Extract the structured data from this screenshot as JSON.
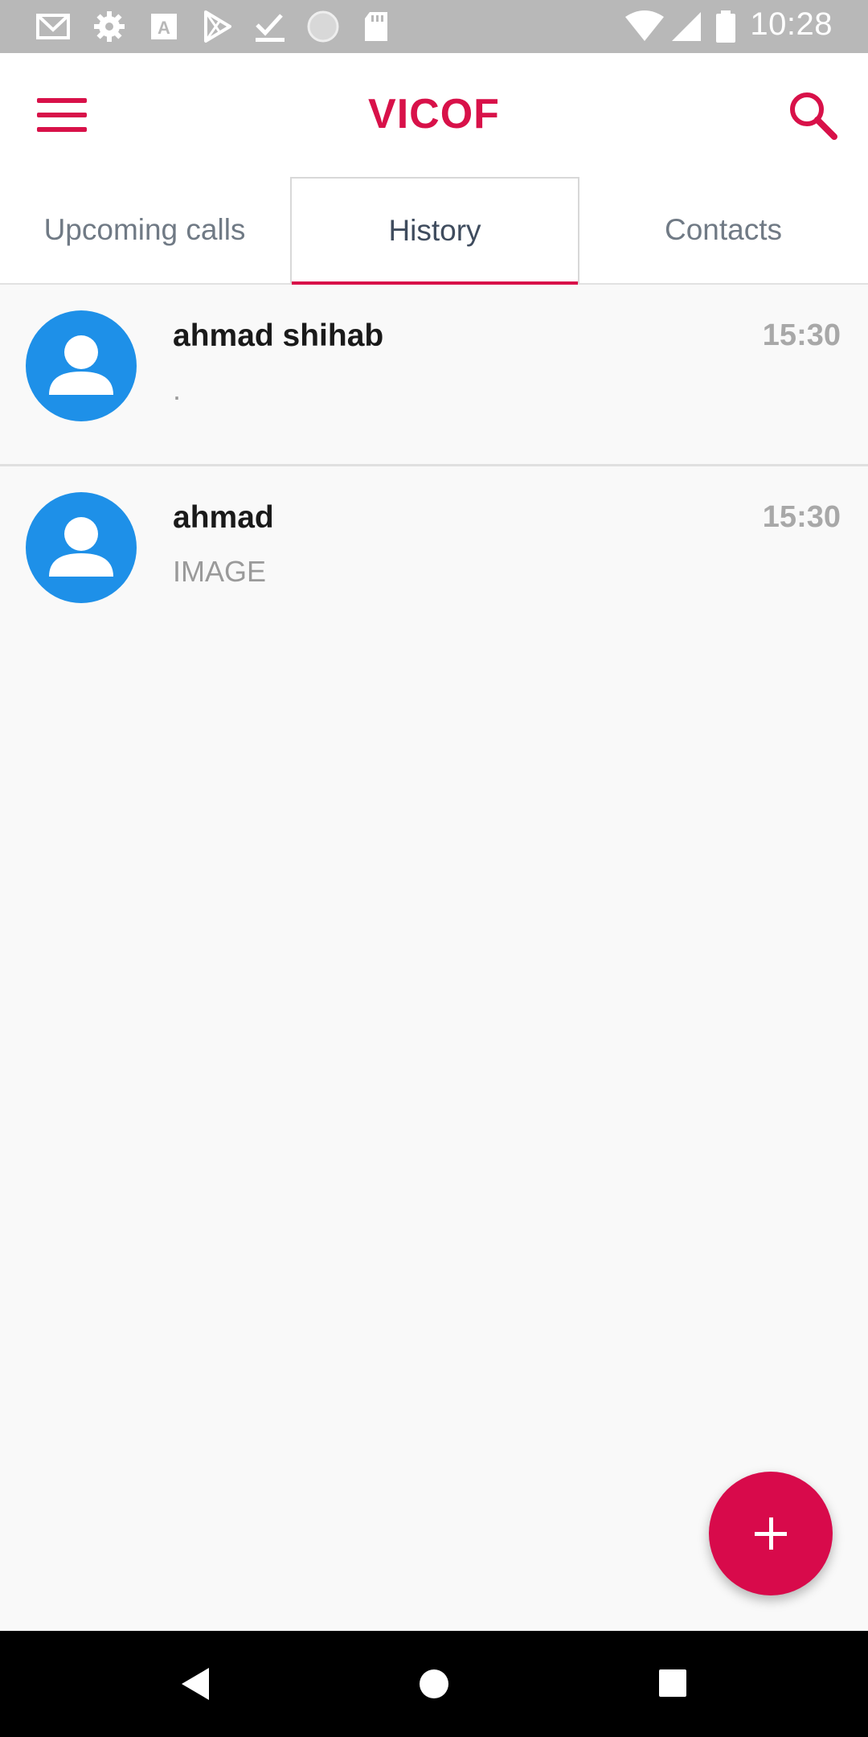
{
  "status_bar": {
    "time": "10:28",
    "icons": [
      "gmail-icon",
      "settings-icon",
      "font-a-icon",
      "play-store-icon",
      "download-done-icon",
      "sync-circle-icon",
      "sd-card-icon",
      "wifi-icon",
      "cell-signal-icon",
      "battery-icon"
    ]
  },
  "app_bar": {
    "title": "VICOF",
    "menu_icon": "hamburger-menu-icon",
    "search_icon": "search-icon"
  },
  "tabs": [
    {
      "label": "Upcoming calls",
      "active": false
    },
    {
      "label": "History",
      "active": true
    },
    {
      "label": "Contacts",
      "active": false
    }
  ],
  "history": [
    {
      "name": "ahmad shihab",
      "time": "15:30",
      "subtitle": "."
    },
    {
      "name": "ahmad",
      "time": "15:30",
      "subtitle": "IMAGE"
    }
  ],
  "fab": {
    "icon": "plus-icon"
  },
  "colors": {
    "accent": "#d81149",
    "avatar": "#1e90e8",
    "status_bar": "#b8b8b8",
    "background": "#f9f9f9"
  },
  "nav_bar": {
    "icons": [
      "back-icon",
      "home-icon",
      "recents-icon"
    ]
  }
}
